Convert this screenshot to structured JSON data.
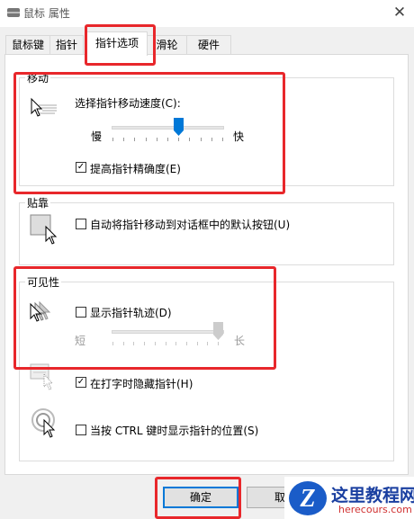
{
  "window": {
    "title": "鼠标 属性",
    "close": "✕"
  },
  "tabs": [
    {
      "label": "鼠标键"
    },
    {
      "label": "指针"
    },
    {
      "label": "指针选项"
    },
    {
      "label": "滑轮"
    },
    {
      "label": "硬件"
    }
  ],
  "motion": {
    "title": "移动",
    "speed_label": "选择指针移动速度(C):",
    "slow": "慢",
    "fast": "快",
    "speed_level": 0.6,
    "precision_label": "提高指针精确度(E)",
    "precision_checked": true
  },
  "snap": {
    "title": "贴靠",
    "label": "自动将指针移动到对话框中的默认按钮(U)",
    "checked": false
  },
  "visibility": {
    "title": "可见性",
    "trails_label": "显示指针轨迹(D)",
    "trails_checked": false,
    "short": "短",
    "long": "长",
    "trails_level": 1.0,
    "hide_label": "在打字时隐藏指针(H)",
    "hide_checked": true,
    "ctrl_label": "当按 CTRL 键时显示指针的位置(S)",
    "ctrl_checked": false
  },
  "buttons": {
    "ok": "确定",
    "cancel": "取"
  },
  "watermark": {
    "title": "这里教程网",
    "url": "herecours.com"
  }
}
